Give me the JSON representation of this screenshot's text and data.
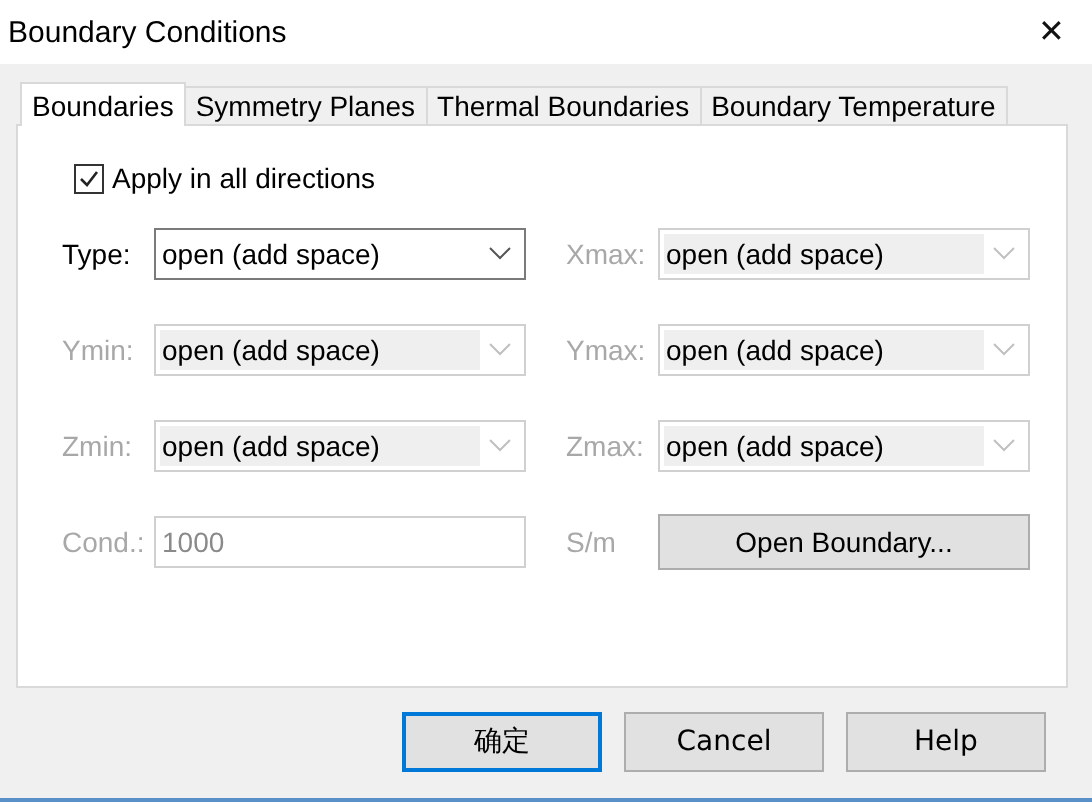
{
  "window": {
    "title": "Boundary Conditions",
    "close": "✕"
  },
  "tabs": [
    {
      "label": "Boundaries",
      "selected": true
    },
    {
      "label": "Symmetry Planes",
      "selected": false
    },
    {
      "label": "Thermal Boundaries",
      "selected": false
    },
    {
      "label": "Boundary Temperature",
      "selected": false
    }
  ],
  "apply_all": {
    "label": "Apply in all directions",
    "checked": true
  },
  "rows": [
    [
      {
        "kind": "combo",
        "label": "Type:",
        "value": "open (add space)",
        "disabled": false
      },
      {
        "kind": "combo",
        "label": "Xmax:",
        "value": "open (add space)",
        "disabled": true
      }
    ],
    [
      {
        "kind": "combo",
        "label": "Ymin:",
        "value": "open (add space)",
        "disabled": true
      },
      {
        "kind": "combo",
        "label": "Ymax:",
        "value": "open (add space)",
        "disabled": true
      }
    ],
    [
      {
        "kind": "combo",
        "label": "Zmin:",
        "value": "open (add space)",
        "disabled": true
      },
      {
        "kind": "combo",
        "label": "Zmax:",
        "value": "open (add space)",
        "disabled": true
      }
    ],
    [
      {
        "kind": "text",
        "label": "Cond.:",
        "value": "1000",
        "disabled": true
      },
      {
        "kind": "button",
        "label": "S/m",
        "value": "Open Boundary..."
      }
    ]
  ],
  "buttons": [
    {
      "label": "确定",
      "default": true
    },
    {
      "label": "Cancel",
      "default": false
    },
    {
      "label": "Help",
      "default": false
    }
  ]
}
